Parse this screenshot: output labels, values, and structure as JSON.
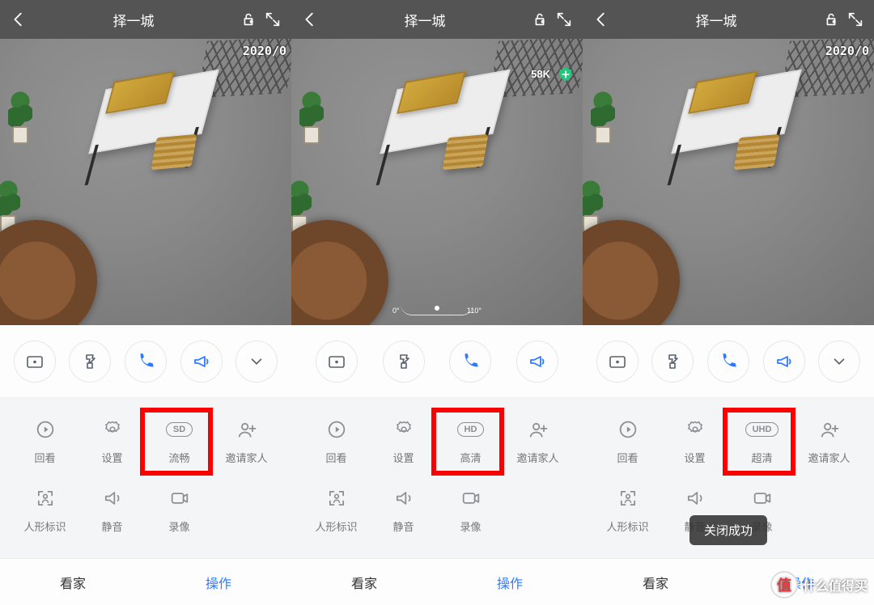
{
  "header": {
    "title": "择一城"
  },
  "timestamp": "2020/0",
  "screens": [
    {
      "quality_badge": "SD",
      "quality_label": "流畅",
      "show_compass": false,
      "bitrate": null,
      "show_shield": false,
      "show_chevron": true,
      "show_human_mark": true,
      "toast": null
    },
    {
      "quality_badge": "HD",
      "quality_label": "高清",
      "show_compass": true,
      "bitrate": "58K",
      "show_shield": true,
      "show_chevron": false,
      "show_human_mark": true,
      "toast": null
    },
    {
      "quality_badge": "UHD",
      "quality_label": "超清",
      "show_compass": false,
      "bitrate": null,
      "show_shield": false,
      "show_chevron": true,
      "show_human_mark": true,
      "toast": "关闭成功"
    }
  ],
  "compass": {
    "left_deg": "0°",
    "right_deg": "110°"
  },
  "panel_labels": {
    "playback": "回看",
    "settings": "设置",
    "invite": "邀请家人",
    "human_mark": "人形标识",
    "mute": "静音",
    "record": "录像"
  },
  "tabs": {
    "home": "看家",
    "operate": "操作"
  },
  "watermark": {
    "text": "什么值得买",
    "logo_char": "值"
  }
}
